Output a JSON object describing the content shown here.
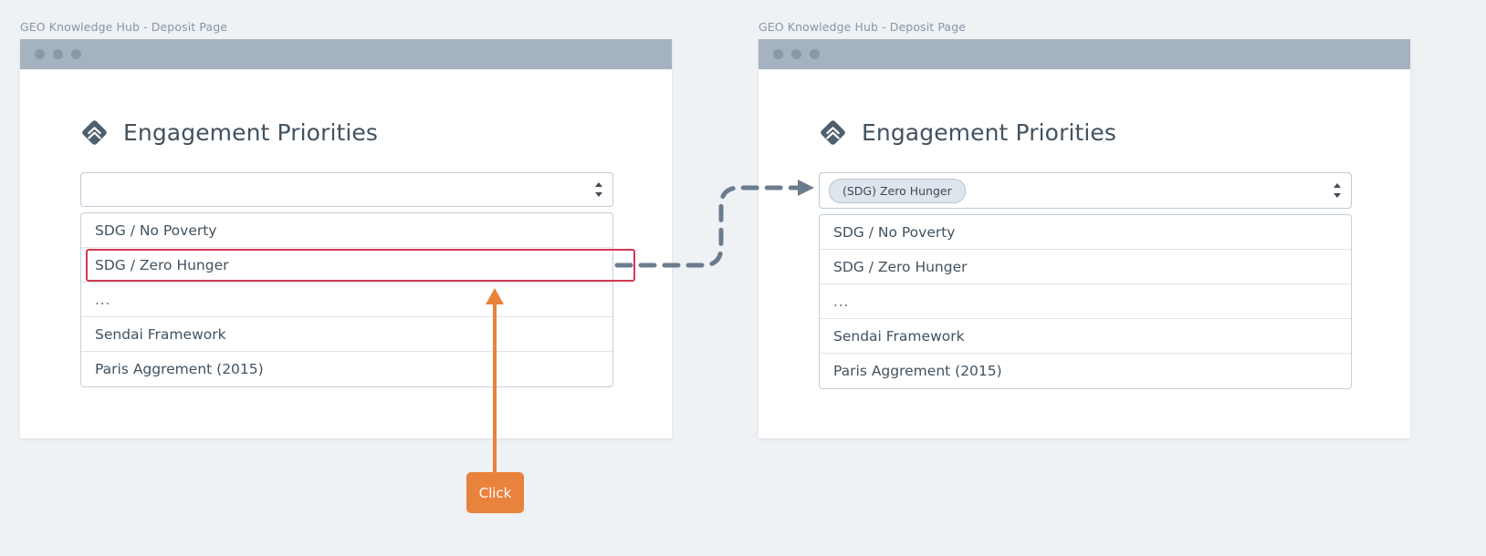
{
  "panels": [
    {
      "caption": "GEO Knowledge Hub - Deposit Page",
      "heading": "Engagement Priorities",
      "icon": "double-chevron-up-diamond-icon",
      "select_value": "",
      "select_placeholder": "",
      "options": [
        "SDG / No Poverty",
        "SDG / Zero Hunger",
        "...",
        "Sendai Framework",
        "Paris Aggrement (2015)"
      ],
      "highlighted_option": "SDG / Zero Hunger"
    },
    {
      "caption": "GEO Knowledge Hub - Deposit Page",
      "heading": "Engagement Priorities",
      "icon": "double-chevron-up-diamond-icon",
      "select_value": "(SDG) Zero Hunger",
      "select_placeholder": "",
      "options": [
        "SDG / No Poverty",
        "SDG / Zero Hunger",
        "...",
        "Sendai Framework",
        "Paris Aggrement (2015)"
      ],
      "highlighted_option": ""
    }
  ],
  "annotations": {
    "click_label": "Click",
    "click_color": "#e9823c",
    "highlight_color": "#d03b54",
    "connector_color": "#6b7c8f"
  },
  "colors": {
    "page_background": "#eef2f5",
    "titlebar": "#a5b2bf",
    "text_primary": "#42525f",
    "caption": "#8896a6",
    "chip_background": "#dfe5ec",
    "border": "#c5d0da"
  }
}
